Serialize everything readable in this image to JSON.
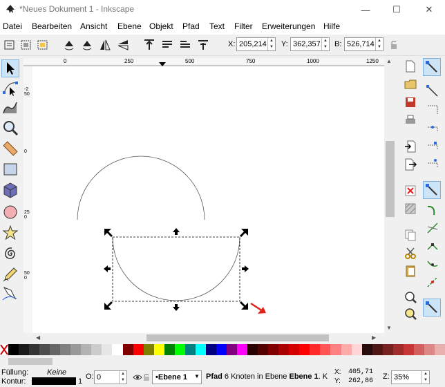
{
  "window": {
    "title": "*Neues Dokument 1 - Inkscape",
    "minimize": "—",
    "maximize": "☐",
    "close": "✕"
  },
  "menu": [
    "Datei",
    "Bearbeiten",
    "Ansicht",
    "Ebene",
    "Objekt",
    "Pfad",
    "Text",
    "Filter",
    "Erweiterungen",
    "Hilfe"
  ],
  "toolbar": {
    "x_label": "X:",
    "x_value": "205,214",
    "y_label": "Y:",
    "y_value": "362,357",
    "w_label": "B:",
    "w_value": "526,714"
  },
  "ruler": {
    "h_ticks": [
      "0",
      "250",
      "500",
      "750",
      "1000",
      "1250"
    ],
    "v_ticks": [
      "-250",
      "0",
      "250",
      "500"
    ]
  },
  "palette": [
    "#000000",
    "#1a1a1a",
    "#333333",
    "#4d4d4d",
    "#666666",
    "#808080",
    "#999999",
    "#b3b3b3",
    "#cccccc",
    "#e6e6e6",
    "#ffffff",
    "#800000",
    "#ff0000",
    "#808000",
    "#ffff00",
    "#008000",
    "#00ff00",
    "#008080",
    "#00ffff",
    "#000080",
    "#0000ff",
    "#800080",
    "#ff00ff",
    "#2b0000",
    "#550000",
    "#800000",
    "#aa0000",
    "#d40000",
    "#ff0000",
    "#ff2a2a",
    "#ff5555",
    "#ff8080",
    "#ffaaaa",
    "#ffd5d5",
    "#280b0b",
    "#501616",
    "#782121",
    "#a02c2c",
    "#c83737",
    "#d35f5f",
    "#de8787",
    "#e9afaf"
  ],
  "status": {
    "fill_label": "Füllung:",
    "fill_value": "Keine",
    "stroke_label": "Kontur:",
    "stroke_width": "1",
    "opacity_label": "O:",
    "opacity_value": "0",
    "layer": "•Ebene 1",
    "message_type": "Pfad",
    "message_rest": " 6 Knoten in Ebene ",
    "message_layer": "Ebene 1",
    "message_tail": ". K",
    "cx_label": "X:",
    "cx_value": "405,71",
    "cy_label": "Y:",
    "cy_value": "262,86",
    "zoom_label": "Z:",
    "zoom_value": "35%"
  }
}
